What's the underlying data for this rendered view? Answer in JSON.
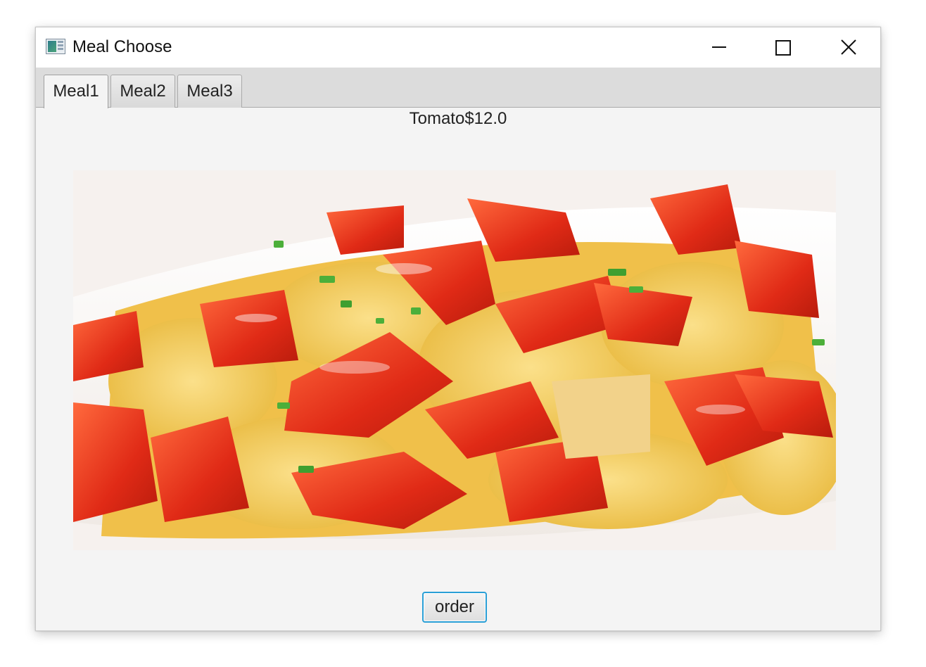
{
  "window": {
    "title": "Meal Choose",
    "icon": "app-window-icon",
    "controls": {
      "minimize": "minimize-icon",
      "maximize": "maximize-icon",
      "close": "close-icon"
    }
  },
  "tabs": [
    {
      "label": "Meal1",
      "selected": true
    },
    {
      "label": "Meal2",
      "selected": false
    },
    {
      "label": "Meal3",
      "selected": false
    }
  ],
  "meal": {
    "label": "Tomato$12.0",
    "image_subject": "scrambled eggs with tomato, chopped scallions, white plate"
  },
  "order_button": {
    "label": "order"
  },
  "colors": {
    "focus_border": "#2a9fd6",
    "window_bg": "#f4f4f4",
    "tabbar_bg": "#dcdcdc",
    "tomato_red": "#e0301e",
    "egg_yellow": "#f2cf5b"
  }
}
